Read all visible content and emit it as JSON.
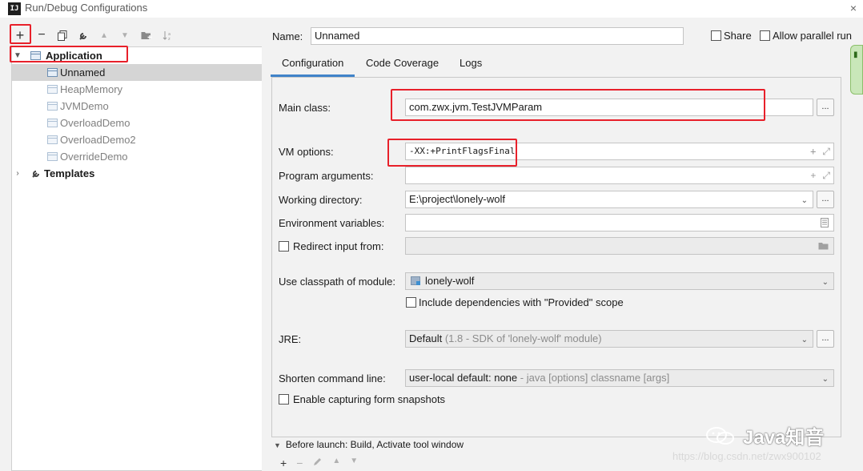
{
  "window": {
    "title": "Run/Debug Configurations",
    "app_icon_text": "IJ",
    "close": "×"
  },
  "toolbar": {
    "add": "+",
    "remove": "−",
    "copy": "copy",
    "edit_defaults": "wrench",
    "move_up": "▲",
    "move_down": "▼",
    "new_folder": "folder",
    "sort": "sort"
  },
  "tree": {
    "application_label": "Application",
    "items": [
      "Unnamed",
      "HeapMemory",
      "JVMDemo",
      "OverloadDemo",
      "OverloadDemo2",
      "OverrideDemo"
    ],
    "templates_label": "Templates"
  },
  "form": {
    "name_label": "Name:",
    "name_value": "Unnamed",
    "share_label": "Share",
    "parallel_label": "Allow parallel run",
    "tabs": [
      "Configuration",
      "Code Coverage",
      "Logs"
    ],
    "main_class_label": "Main class:",
    "main_class_value": "com.zwx.jvm.TestJVMParam",
    "vm_options_label": "VM options:",
    "vm_options_value": "-XX:+PrintFlagsFinal",
    "program_args_label": "Program arguments:",
    "program_args_value": "",
    "working_dir_label": "Working directory:",
    "working_dir_value": "E:\\project\\lonely-wolf",
    "env_vars_label": "Environment variables:",
    "env_vars_value": "",
    "redirect_label": "Redirect input from:",
    "classpath_label": "Use classpath of module:",
    "classpath_value": "lonely-wolf",
    "include_deps_label": "Include dependencies with \"Provided\" scope",
    "jre_label": "JRE:",
    "jre_value": "Default",
    "jre_hint": "(1.8 - SDK of 'lonely-wolf' module)",
    "shorten_label": "Shorten command line:",
    "shorten_value": "user-local default: none",
    "shorten_hint": "- java [options] classname [args]",
    "snapshots_label": "Enable capturing form snapshots",
    "ellipsis": "...",
    "expand": "⤢",
    "plus": "+"
  },
  "before_launch": {
    "label": "Before launch: Build, Activate tool window"
  },
  "watermark": {
    "text": "Java知音",
    "url": "https://blog.csdn.net/zwx900102"
  },
  "colors": {
    "accent": "#4083c9",
    "highlight": "#e8202a",
    "selection": "#d5d5d5"
  }
}
